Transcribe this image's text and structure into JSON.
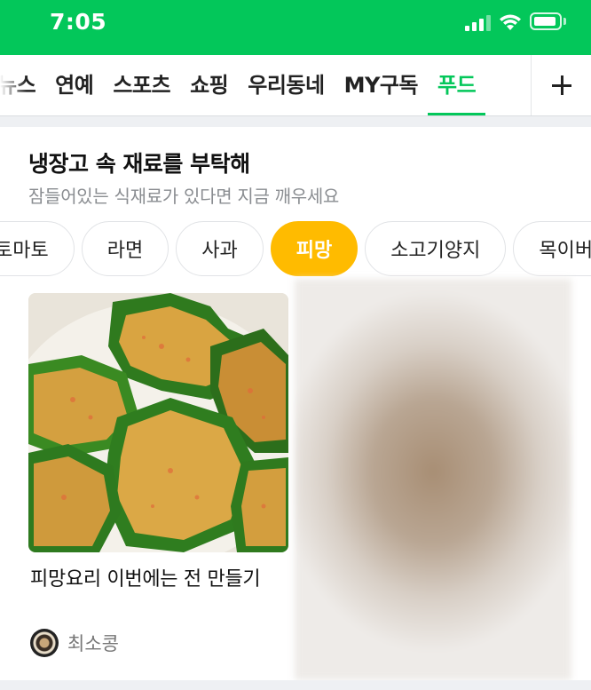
{
  "status_bar": {
    "time": "7:05",
    "background_color": "#03c75a",
    "icons": [
      "signal-icon",
      "wifi-icon",
      "battery-icon"
    ]
  },
  "tab_bar": {
    "tabs": [
      {
        "label": "뉴스",
        "active": false
      },
      {
        "label": "연예",
        "active": false
      },
      {
        "label": "스포츠",
        "active": false
      },
      {
        "label": "쇼핑",
        "active": false
      },
      {
        "label": "우리동네",
        "active": false
      },
      {
        "label": "MY구독",
        "active": false
      },
      {
        "label": "푸드",
        "active": true
      }
    ],
    "add_icon": "plus-icon",
    "active_color": "#03c75a"
  },
  "section": {
    "title": "냉장고 속 재료를 부탁해",
    "subtitle": "잠들어있는 식재료가 있다면 지금 깨우세요",
    "chips": [
      {
        "label": "토마토",
        "active": false
      },
      {
        "label": "라면",
        "active": false
      },
      {
        "label": "사과",
        "active": false
      },
      {
        "label": "피망",
        "active": true
      },
      {
        "label": "소고기양지",
        "active": false
      },
      {
        "label": "목이버섯",
        "active": false
      }
    ],
    "chip_active_color": "#ffbb00",
    "post": {
      "title": "피망요리 이번에는 전 만들기",
      "author": "최소콩"
    }
  }
}
